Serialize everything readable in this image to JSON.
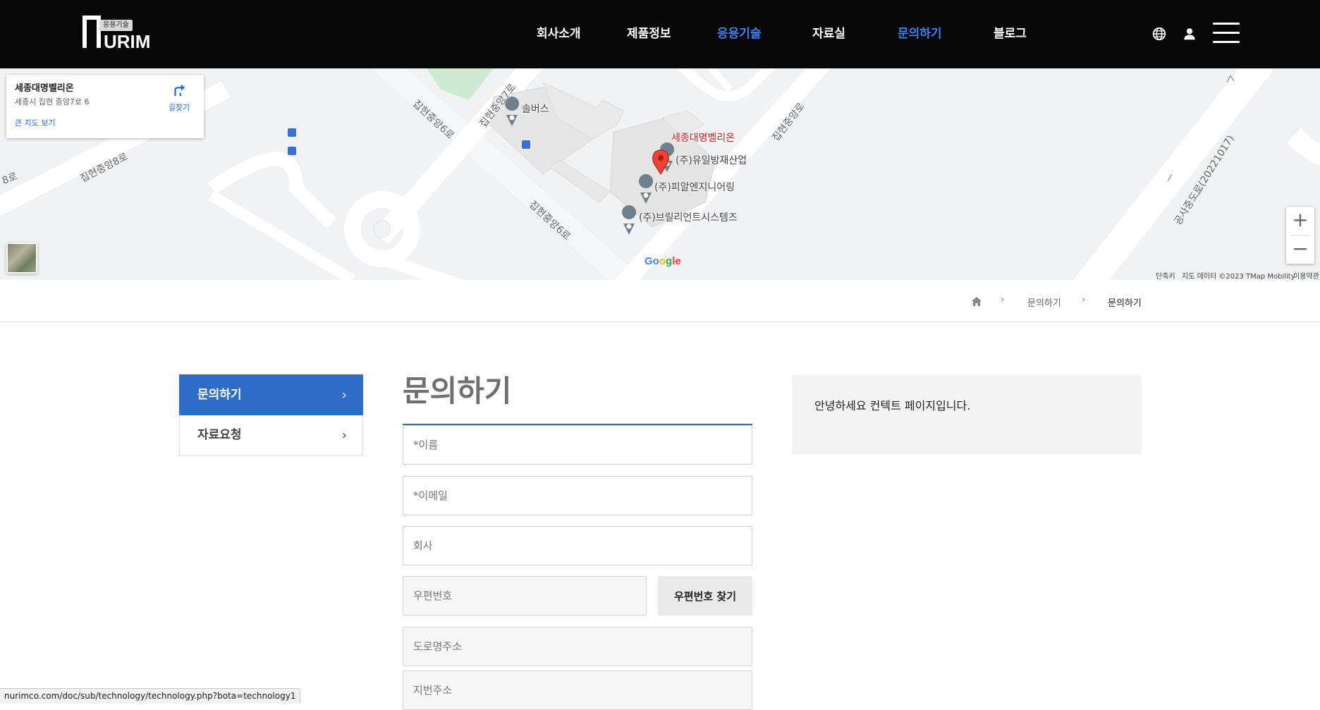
{
  "header": {
    "logo_badge": "응용기술",
    "logo_word": "URIM",
    "nav": [
      {
        "label": "회사소개",
        "active": false
      },
      {
        "label": "제품정보",
        "active": false
      },
      {
        "label": "응용기술",
        "active": true
      },
      {
        "label": "자료실",
        "active": false
      },
      {
        "label": "문의하기",
        "active": true
      },
      {
        "label": "블로그",
        "active": false
      }
    ]
  },
  "map": {
    "card": {
      "place_name": "세종대명벨리온",
      "address": "세종시 집현 중앙7로 6",
      "directions_label": "길찾기",
      "larger_map_label": "큰 지도 보기"
    },
    "pins": [
      {
        "label": "솔버스"
      },
      {
        "label": "세종대명벨리온"
      },
      {
        "label": "(주)유일방재산업"
      },
      {
        "label": "(주)피알엔지니어링"
      },
      {
        "label": "(주)브릴리언트시스템즈"
      }
    ],
    "roads": [
      "집현중앙6로",
      "집현중앙7로",
      "집현중앙8로",
      "집현중앙6로",
      "집현중앙로",
      "공사중도로(20221017)",
      "8로"
    ],
    "zoom_in": "+",
    "zoom_out": "−",
    "footer": {
      "shortcuts": "단축키",
      "data": "지도 데이터 ©2023 TMap Mobility",
      "terms": "이용약관"
    },
    "google_logo": "Google"
  },
  "breadcrumb": {
    "items": [
      "문의하기",
      "문의하기"
    ]
  },
  "side_menu": [
    {
      "label": "문의하기",
      "active": true
    },
    {
      "label": "자료요청",
      "active": false
    }
  ],
  "form": {
    "title": "문의하기",
    "name_placeholder": "*이름",
    "email_placeholder": "*이메일",
    "company_placeholder": "회사",
    "zip_placeholder": "우편번호",
    "zip_button": "우편번호 찾기",
    "road_address_placeholder": "도로명주소",
    "lot_address_placeholder": "지번주소"
  },
  "info_box": {
    "text": "안녕하세요 컨텍트 페이지입니다."
  },
  "status_bar": {
    "url": "nurimco.com/doc/sub/technology/technology.php?bota=technology1"
  },
  "colors": {
    "header_bg": "#070707",
    "accent_blue": "#2f6ec8",
    "nav_active": "#3a82f0",
    "pin_red": "#ea4335"
  }
}
